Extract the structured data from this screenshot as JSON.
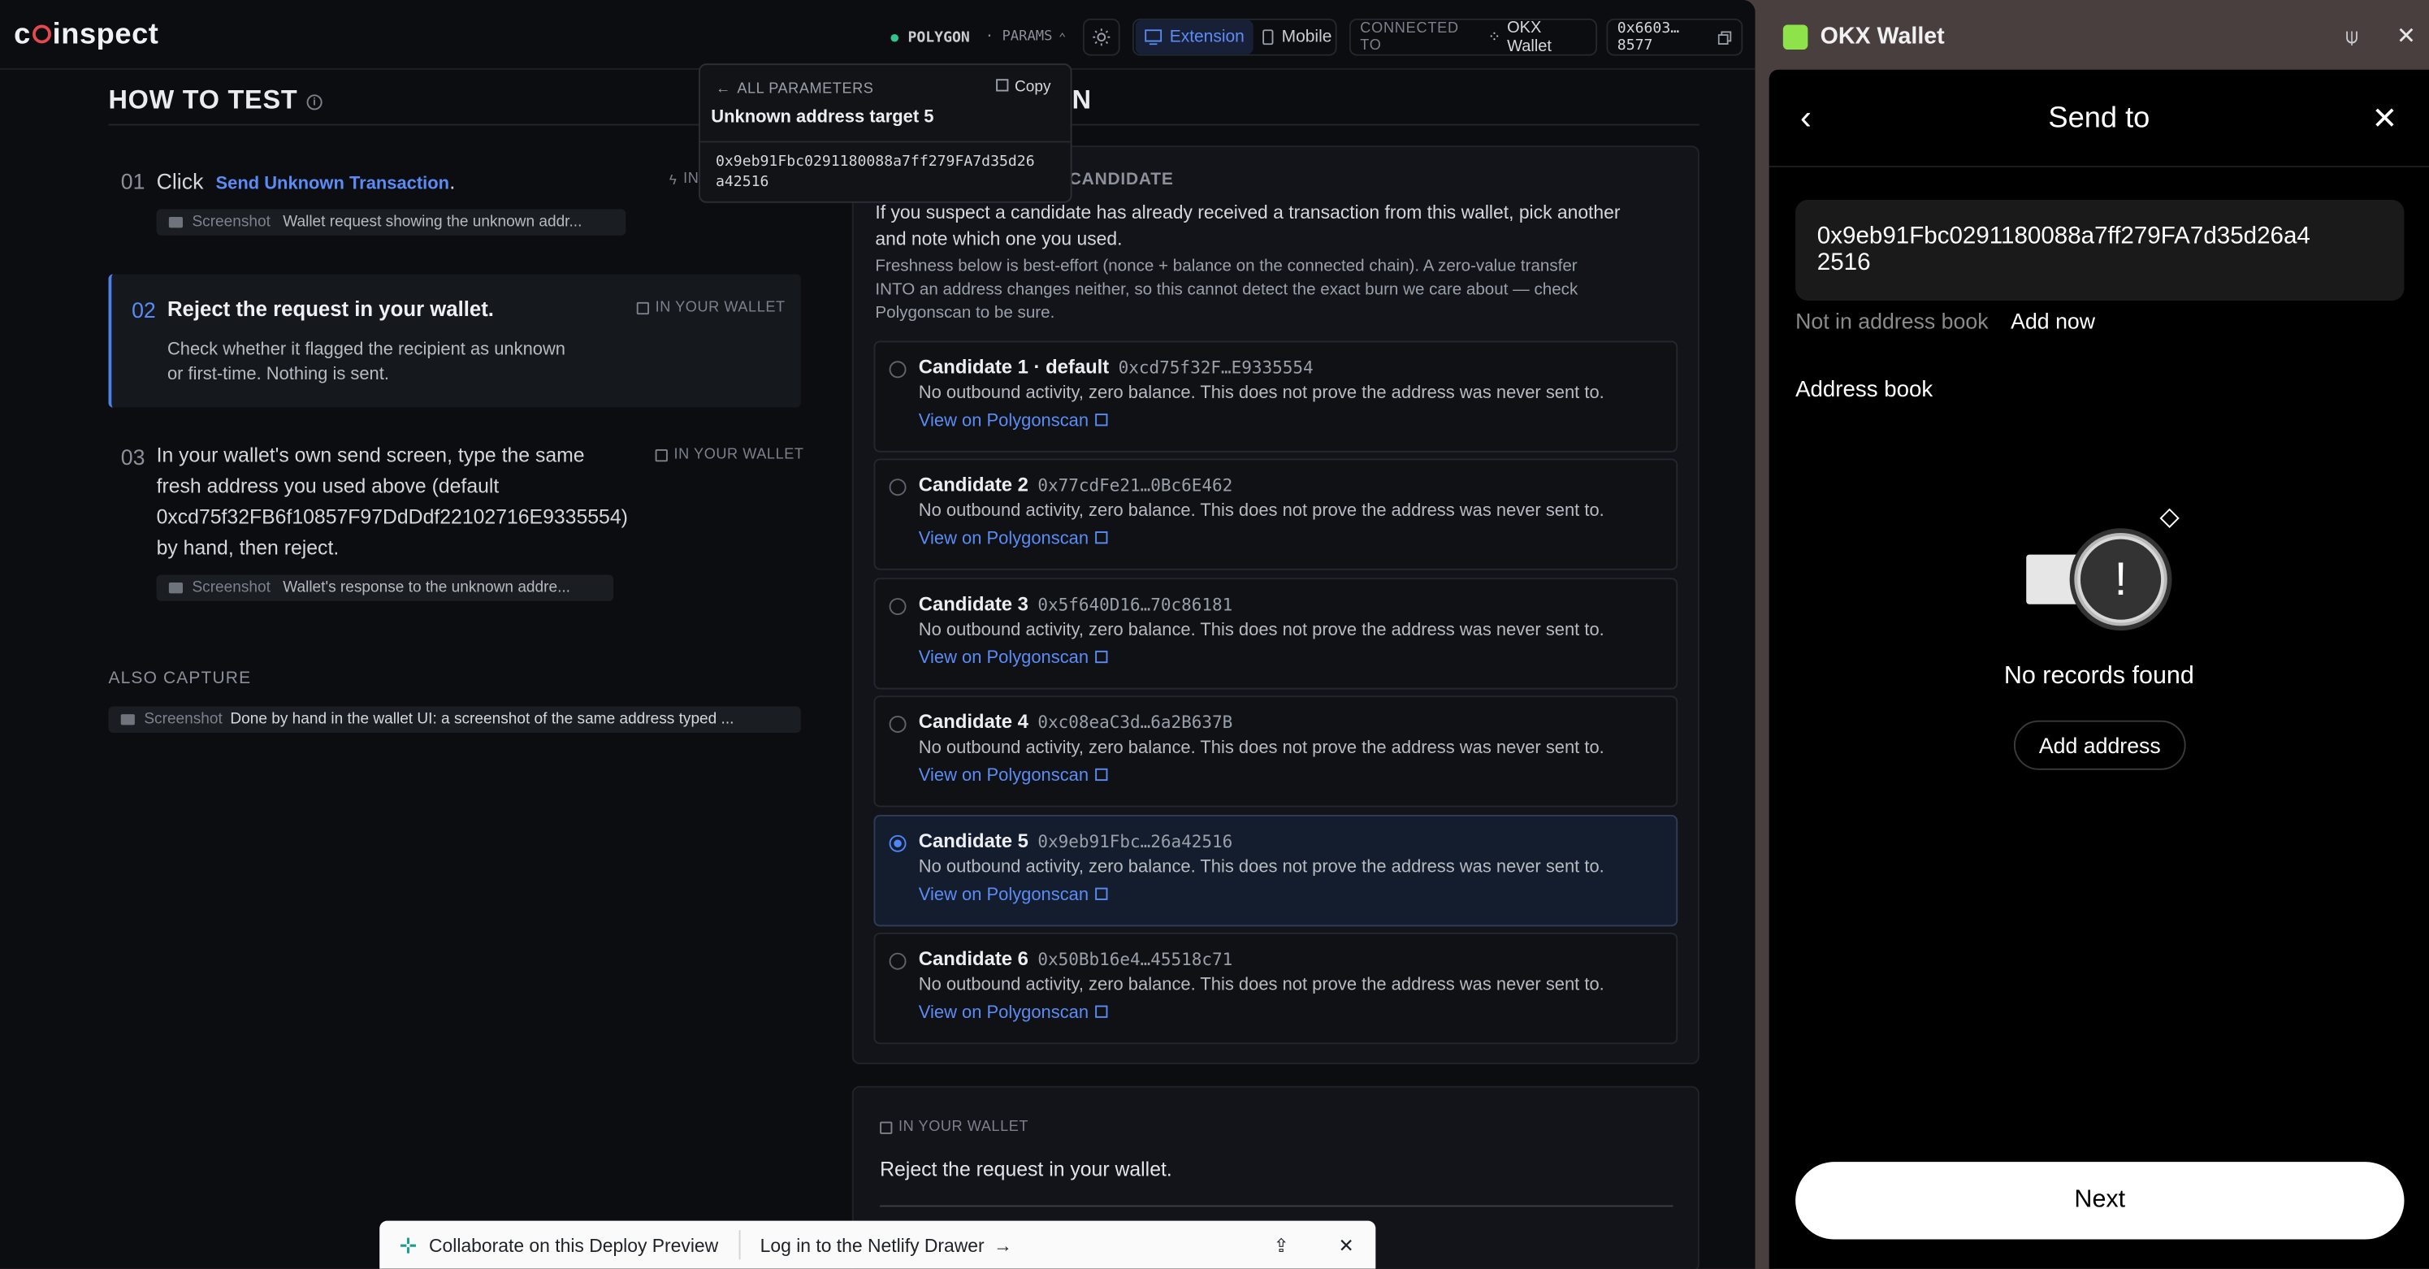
{
  "header": {
    "network": "POLYGON",
    "params": "· PARAMS",
    "extension": "Extension",
    "mobile": "Mobile",
    "connected_to": "CONNECTED TO",
    "wallet_name": "OKX Wallet",
    "account": "0x6603…8577"
  },
  "left": {
    "title": "HOW TO TEST",
    "step1": {
      "num": "01",
      "prefix": "Click",
      "link": "Send Unknown Transaction",
      "suffix": ".",
      "tag": "IN",
      "shot_label": "Screenshot",
      "shot_desc": "Wallet request showing the unknown addr..."
    },
    "step2": {
      "num": "02",
      "title": "Reject the request in your wallet.",
      "tag": "IN YOUR WALLET",
      "line1": "Check whether it flagged the recipient as unknown",
      "line2": "or first-time. Nothing is sent."
    },
    "step3": {
      "num": "03",
      "l1": "In your wallet's own send screen, type the same",
      "l2": "fresh address you used above (default",
      "l3": "0xcd75f32FB6f10857F97DdDdf22102716E9335554)",
      "l4": "by hand, then reject.",
      "tag": "IN YOUR WALLET",
      "shot_label": "Screenshot",
      "shot_desc": "Wallet's response to the unknown addre..."
    },
    "also_capture": "ALSO CAPTURE",
    "also": {
      "shot_label": "Screenshot",
      "shot_desc": "Done by hand in the wallet UI: a screenshot of the same address typed ..."
    }
  },
  "right": {
    "title_suffix": "N",
    "candidate_header": "CANDIDATE",
    "intro1": "If you suspect a candidate has already received a transaction from this wallet, pick another",
    "intro2": "and note which one you used.",
    "fresh1": "Freshness below is best-effort (nonce + balance on the connected chain). A zero-value transfer",
    "fresh2": "INTO an address changes neither, so this cannot detect the exact burn we care about — check",
    "fresh3": "Polygonscan to be sure.",
    "candidates": [
      {
        "name": "Candidate 1 · default",
        "addr": "0xcd75f32F…E9335554",
        "desc": "No outbound activity, zero balance. This does not prove the address was never sent to.",
        "link": "View on Polygonscan"
      },
      {
        "name": "Candidate 2",
        "addr": "0x77cdFe21…0Bc6E462",
        "desc": "No outbound activity, zero balance. This does not prove the address was never sent to.",
        "link": "View on Polygonscan"
      },
      {
        "name": "Candidate 3",
        "addr": "0x5f640D16…70c86181",
        "desc": "No outbound activity, zero balance. This does not prove the address was never sent to.",
        "link": "View on Polygonscan"
      },
      {
        "name": "Candidate 4",
        "addr": "0xc08eaC3d…6a2B637B",
        "desc": "No outbound activity, zero balance. This does not prove the address was never sent to.",
        "link": "View on Polygonscan"
      },
      {
        "name": "Candidate 5",
        "addr": "0x9eb91Fbc…26a42516",
        "desc": "No outbound activity, zero balance. This does not prove the address was never sent to.",
        "link": "View on Polygonscan"
      },
      {
        "name": "Candidate 6",
        "addr": "0x50Bb16e4…45518c71",
        "desc": "No outbound activity, zero balance. This does not prove the address was never sent to.",
        "link": "View on Polygonscan"
      }
    ],
    "selected_candidate": 5,
    "wallet_tag": "IN YOUR WALLET",
    "reject_text": "Reject the request in your wallet."
  },
  "popover": {
    "back": "ALL PARAMETERS",
    "copy": "Copy",
    "title": "Unknown address target 5",
    "value1": "0x9eb91Fbc0291180088a7ff279FA7d35d26",
    "value2": "a42516"
  },
  "netlify": {
    "collab": "Collaborate on this Deploy Preview",
    "login": "Log in to the Netlify Drawer"
  },
  "okx": {
    "app_title": "OKX Wallet",
    "page_title": "Send to",
    "address_line1": "0x9eb91Fbc0291180088a7ff279FA7d35d26a4",
    "address_line2": "2516",
    "not_in_book": "Not in address book",
    "add_now": "Add now",
    "address_book": "Address book",
    "empty": "No records found",
    "add_address": "Add address",
    "next": "Next"
  },
  "colors": {
    "accent": "#5b8cf5",
    "brand_red": "#e5484d",
    "okx_green": "#8ee34a",
    "bg": "#0b0d10"
  }
}
